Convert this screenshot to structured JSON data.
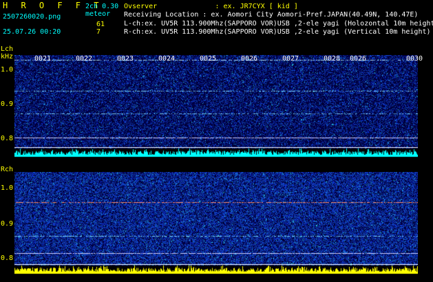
{
  "header": {
    "app_title": "H R O F F T",
    "mode": "2ch 0.30",
    "signal_type": "meteor",
    "filename": "2507260020.png",
    "datetime": "25.07.26 00:20",
    "count_l": "61",
    "count_r": "7",
    "observer": "Ovserver              : ex. JR7CYX [ kid ]",
    "location": "Receiving Location : ex. Aomori City Aomori-Pref.JAPAN(40.49N, 140.47E)",
    "lch_info": "L-ch:ex. UV5R 113.900Mhz(SAPPORO VOR)USB ,2-ele yagi (Holozontal 10m height",
    "rch_info": "R-ch:ex. UV5R 113.900Mhz(SAPPORO VOR)USB ,2-ele yagi (Vertical 10m height)"
  },
  "lch": {
    "label": "Lch",
    "unit": "kHz",
    "ticks": [
      "1.0",
      "0.9",
      "0.8"
    ],
    "time_marks": [
      "0021",
      "0022",
      "0023",
      "0024",
      "0025",
      "0026",
      "0027",
      "0028",
      "0026",
      "0030"
    ]
  },
  "rch": {
    "label": "Rch",
    "ticks": [
      "1.0",
      "0.9",
      "0.8"
    ]
  },
  "colors": {
    "accent": "#ffff00",
    "info_text": "#ffffff",
    "header_cyan": "#00ffff",
    "noise_floor": "#000066",
    "lch_spectrum": "#00ffff",
    "rch_spectrum": "#ffff00"
  }
}
